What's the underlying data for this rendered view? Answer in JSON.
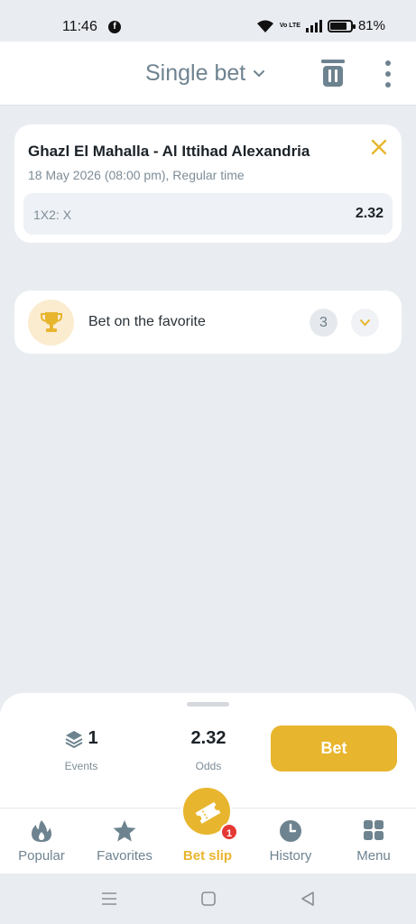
{
  "status_bar": {
    "time": "11:46",
    "network": "Vo LTE",
    "battery_percent": "81%",
    "battery_level": 0.81
  },
  "header": {
    "title": "Single bet"
  },
  "bet": {
    "match": "Ghazl El Mahalla - Al Ittihad Alexandria",
    "details": "18 May 2026 (08:00 pm), Regular time",
    "market": "1X2: X",
    "odds": "2.32"
  },
  "favorite": {
    "label": "Bet on the favorite",
    "count": "3"
  },
  "summary": {
    "events_count": "1",
    "events_label": "Events",
    "odds_value": "2.32",
    "odds_label": "Odds",
    "bet_button": "Bet"
  },
  "nav": {
    "items": [
      {
        "label": "Popular",
        "icon": "flame-icon"
      },
      {
        "label": "Favorites",
        "icon": "star-icon"
      },
      {
        "label": "Bet slip",
        "icon": "ticket-icon",
        "badge": "1"
      },
      {
        "label": "History",
        "icon": "clock-icon"
      },
      {
        "label": "Menu",
        "icon": "grid-icon"
      }
    ]
  },
  "colors": {
    "accent": "#e8b52e",
    "background": "#e9ecf1",
    "muted_text": "#7d8c97",
    "badge": "#e53935"
  }
}
